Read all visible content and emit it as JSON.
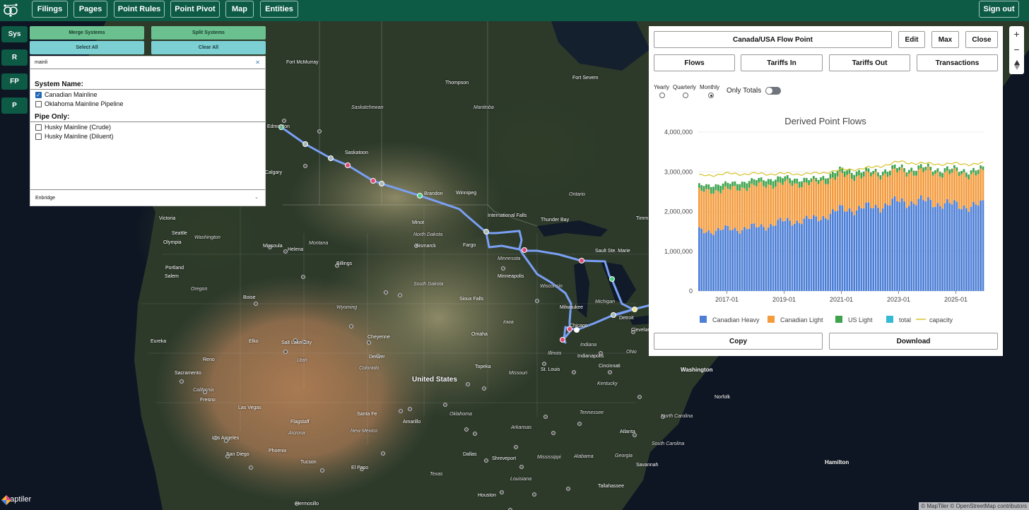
{
  "nav": {
    "filings": "Filings",
    "pages": "Pages",
    "point_rules": "Point Rules",
    "point_pivot": "Point Pivot",
    "map": "Map",
    "entities": "Entities",
    "sign_out": "Sign out"
  },
  "side_buttons": {
    "sys": "Sys",
    "r": "R",
    "fp": "FP",
    "p": "P"
  },
  "filter": {
    "merge": "Merge Systems",
    "split": "Split Systems",
    "select_all": "Select All",
    "clear_all": "Clear All",
    "search_value": "mainli",
    "clear_icon": "✕",
    "group_system": "System Name:",
    "group_pipe": "Pipe Only:",
    "system_options": [
      {
        "label": "Canadian Mainline",
        "checked": true
      },
      {
        "label": "Oklahoma Mainline Pipeline",
        "checked": false
      }
    ],
    "pipe_options": [
      {
        "label": "Husky Mainline (Crude)",
        "checked": false
      },
      {
        "label": "Husky Mainline (Diluent)",
        "checked": false
      }
    ],
    "company": "Enbridge"
  },
  "panel": {
    "title": "Canada/USA Flow Point",
    "edit": "Edit",
    "max": "Max",
    "close": "Close",
    "tabs": [
      "Flows",
      "Tariffs In",
      "Tariffs Out",
      "Transactions"
    ],
    "periods": [
      "Yearly",
      "Quarterly",
      "Monthly"
    ],
    "selected_period": "Monthly",
    "only_totals": "Only Totals",
    "copy": "Copy",
    "download": "Download"
  },
  "chart_data": {
    "type": "bar",
    "title": "Derived Point Flows",
    "stacked": true,
    "x_start": "2016-01",
    "x_end": "2025-12",
    "x_ticks": [
      "2017-01",
      "2019-01",
      "2021-01",
      "2023-01",
      "2025-01"
    ],
    "y_ticks": [
      "0",
      "1,000,000",
      "2,000,000",
      "3,000,000",
      "4,000,000"
    ],
    "ylim": [
      0,
      4000000
    ],
    "series": [
      {
        "name": "Canadian Heavy",
        "color": "#4d7fd6",
        "values_sample_yearly": [
          1500000,
          1550000,
          1600000,
          1750000,
          1800000,
          2050000,
          2100000,
          2250000,
          2250000,
          2150000
        ]
      },
      {
        "name": "Canadian Light",
        "color": "#f39b3d",
        "values_sample_yearly": [
          1000000,
          1000000,
          1050000,
          950000,
          900000,
          850000,
          800000,
          750000,
          750000,
          800000
        ]
      },
      {
        "name": "US Light",
        "color": "#3ea34c",
        "values_sample_yearly": [
          150000,
          150000,
          150000,
          150000,
          100000,
          150000,
          100000,
          100000,
          100000,
          100000
        ]
      },
      {
        "name": "total",
        "color": "#35b9d4"
      },
      {
        "name": "capacity",
        "color": "#d6c22b",
        "line": true,
        "values_sample_yearly": [
          2900000,
          2950000,
          2950000,
          2950000,
          2950000,
          3050000,
          3100000,
          3250000,
          3200000,
          3200000
        ]
      }
    ],
    "legend_position": "bottom"
  },
  "map": {
    "labels": {
      "fort_mcmurray": "Fort McMurray",
      "thompson": "Thompson",
      "fort_severn": "Fort Severn",
      "saskatchewan": "Saskatchewan",
      "manitoba": "Manitoba",
      "edmonton": "Edmonton",
      "saskatoon": "Saskatoon",
      "calgary": "Calgary",
      "brandon": "Brandon",
      "winnipeg": "Winnipeg",
      "ontario": "Ontario",
      "international_falls": "International Falls",
      "thunder_bay": "Thunder Bay",
      "victoria": "Victoria",
      "seattle": "Seattle",
      "olympia": "Olympia",
      "washington": "Washington",
      "minot": "Minot",
      "north_dakota": "North Dakota",
      "bismarck": "Bismarck",
      "fargo": "Fargo",
      "missoula": "Missoula",
      "helena": "Helena",
      "montana": "Montana",
      "minnesota": "Minnesota",
      "sault_ste_marie": "Sault Ste. Marie",
      "portland": "Portland",
      "salem": "Salem",
      "oregon": "Oregon",
      "billings": "Billings",
      "south_dakota": "South Dakota",
      "minneapolis": "Minneapolis",
      "wisconsin": "Wisconsin",
      "michigan": "Michigan",
      "boise": "Boise",
      "wyoming": "Wyoming",
      "sioux_falls": "Sioux Falls",
      "milwaukee": "Milwaukee",
      "detroit": "Detroit",
      "chicago": "Chicago",
      "iowa": "Iowa",
      "omaha": "Omaha",
      "cheyenne": "Cheyenne",
      "eureka": "Eureka",
      "reno": "Reno",
      "elko": "Elko",
      "salt_lake_city": "Salt Lake City",
      "utah": "Utah",
      "denver": "Denver",
      "colorado": "Colorado",
      "illinois": "Illinois",
      "indiana": "Indiana",
      "indianapolis": "Indianapolis",
      "ohio": "Ohio",
      "cleveland": "Clevelan",
      "washington_dc": "Washington",
      "sacramento": "Sacramento",
      "california": "California",
      "fresno": "Fresno",
      "topeka": "Topeka",
      "united_states": "United States",
      "missouri": "Missouri",
      "st_louis": "St. Louis",
      "cincinnati": "Cincinnati",
      "kentucky": "Kentucky",
      "norfolk": "Norfolk",
      "las_vegas": "Las Vegas",
      "santa_fe": "Santa Fe",
      "amarillo": "Amarillo",
      "oklahoma": "Oklahoma",
      "tennessee": "Tennessee",
      "north_carolina": "North Carolina",
      "los_angeles": "Los Angeles",
      "flagstaff": "Flagstaff",
      "arizona": "Arizona",
      "new_mexico": "New Mexico",
      "arkansas": "Arkansas",
      "atlanta": "Atlanta",
      "south_carolina": "South Carolina",
      "san_diego": "San Diego",
      "phoenix": "Phoenix",
      "tucson": "Tucson",
      "el_paso": "El Paso",
      "dallas": "Dallas",
      "shreveport": "Shreveport",
      "mississippi": "Mississippi",
      "georgia": "Georgia",
      "alabama": "Alabama",
      "savannah": "Savannah",
      "texas": "Texas",
      "louisiana": "Louisiana",
      "tallahassee": "Tallahassee",
      "hamilton": "Hamilton",
      "hermosillo": "Hermosillo",
      "houston": "Houston",
      "timmins": "Timm"
    },
    "brand": "maptiler",
    "attribution": "© MapTiler © OpenStreetMap contributors"
  }
}
